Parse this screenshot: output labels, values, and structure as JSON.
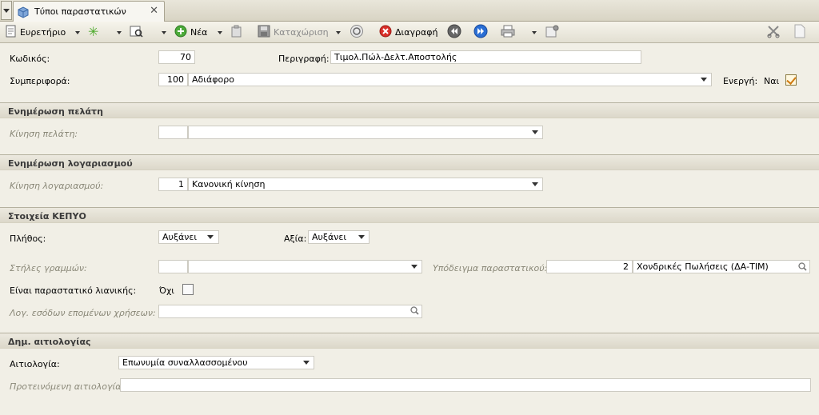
{
  "tab": {
    "title": "Τύποι παραστατικών"
  },
  "toolbar": {
    "index_label": "Ευρετήριο",
    "new_label": "Νέα",
    "save_label": "Καταχώριση",
    "delete_label": "Διαγραφή"
  },
  "form": {
    "code_label": "Κωδικός:",
    "code_value": "70",
    "description_label": "Περιγραφή:",
    "description_value": "Τιμολ.Πώλ-Δελτ.Αποστολής",
    "behavior_label": "Συμπεριφορά:",
    "behavior_code": "100",
    "behavior_value": "Αδιάφορο",
    "active_label": "Ενεργή:",
    "active_value": "Ναι"
  },
  "customer_section": {
    "title": "Ενημέρωση πελάτη",
    "movement_label": "Κίνηση πελάτη:",
    "movement_code": "",
    "movement_value": ""
  },
  "account_section": {
    "title": "Ενημέρωση λογαριασμού",
    "movement_label": "Κίνηση λογαριασμού:",
    "movement_code": "1",
    "movement_value": "Κανονική κίνηση"
  },
  "kepyo_section": {
    "title": "Στοιχεία ΚΕΠΥΟ",
    "quantity_label": "Πλήθος:",
    "quantity_value": "Αυξάνει",
    "value_label": "Αξία:",
    "value_value": "Αυξάνει",
    "line_columns_label": "Στήλες γραμμών:",
    "line_columns_code": "",
    "line_columns_value": "",
    "doc_template_label": "Υπόδειγμα παραστατικού:",
    "doc_template_code": "2",
    "doc_template_value": "Χονδρικές Πωλήσεις (ΔΑ-ΤΙΜ)",
    "retail_label": "Είναι παραστατικό λιανικής:",
    "retail_value": "Όχι",
    "future_income_label": "Λογ. εσόδων επομένων χρήσεων:",
    "future_income_value": ""
  },
  "reason_section": {
    "title": "Δημ. αιτιολογίας",
    "reason_label": "Αιτιολογία:",
    "reason_value": "Επωνυμία συναλλασσομένου",
    "suggested_label": "Προτεινόμενη αιτιολογία:",
    "suggested_value": ""
  }
}
